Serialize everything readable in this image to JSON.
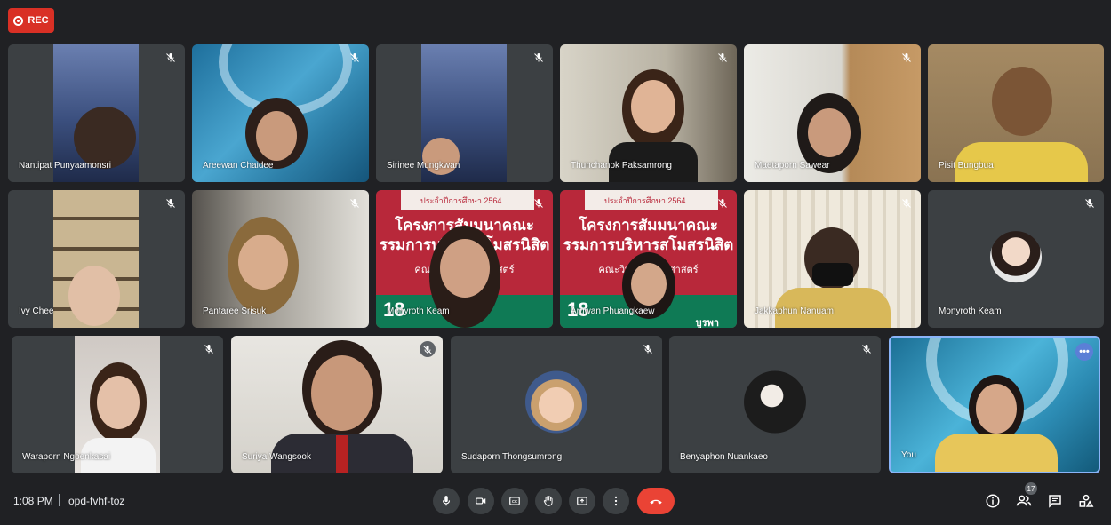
{
  "recording": {
    "label": "REC"
  },
  "participants": [
    {
      "name": "Nantipat Punyaamonsri"
    },
    {
      "name": "Areewan Chaidee"
    },
    {
      "name": "Sirinee Mungkwan"
    },
    {
      "name": "Thunchanok Paksamrong"
    },
    {
      "name": "Maetaporn Sawear"
    },
    {
      "name": "Pisit Bungbua"
    },
    {
      "name": "Ivy Chee"
    },
    {
      "name": "Pantaree Srisuk"
    },
    {
      "name": "Monyroth Keam"
    },
    {
      "name": "Aruwan Phuangkaew"
    },
    {
      "name": "Jakkaphun Nanuam"
    },
    {
      "name": "Monyroth Keam"
    },
    {
      "name": "Waraporn Ngoenkasai"
    },
    {
      "name": "Suriya Wangsook"
    },
    {
      "name": "Sudaporn Thongsumrong"
    },
    {
      "name": "Benyaphon Nuankaeo"
    },
    {
      "name": "You"
    }
  ],
  "slide": {
    "top": "ประจำปีการศึกษา 2564",
    "line1": "โครงการสัมมนาคณะ",
    "line2": "รรมการบริหารสโมสรนิสิต",
    "line3": "คณะวิทยา     สังคมศาสตร์",
    "number": "18",
    "footer": "บูรพา"
  },
  "meeting": {
    "time": "1:08 PM",
    "code": "opd-fvhf-toz",
    "participant_count": "17"
  },
  "icons": {
    "mic": "mic-icon",
    "camera": "camera-icon",
    "captions": "captions-icon",
    "hand": "raise-hand-icon",
    "present": "present-icon",
    "more": "more-options-icon",
    "hangup": "hangup-icon",
    "info": "info-icon",
    "people": "people-icon",
    "chat": "chat-icon",
    "activities": "activities-icon"
  },
  "colors": {
    "background": "#202124",
    "tile": "#3c4043",
    "hangup": "#ea4335",
    "rec": "#d93025",
    "active_border": "#8ab4f8"
  }
}
